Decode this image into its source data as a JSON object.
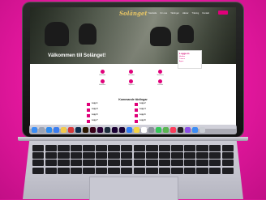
{
  "site": {
    "logo_text": "Solänget",
    "nav_items": [
      "Startsida",
      "Om oss",
      "Tävlingar",
      "Hästar",
      "Träning",
      "Kontakt"
    ],
    "hero_title": "Välkommen till Solänget!",
    "login_box": {
      "title": "Logga in",
      "links": [
        "Medlem",
        "Tränare",
        "Ägare"
      ]
    },
    "quick_links": [
      "Kalender",
      "Resultat",
      "Startlistor",
      "Anmälan",
      "Nyheter",
      "Kontakt"
    ],
    "upcoming_title": "Kommande tävlingar",
    "races": [
      {
        "name": "Lopp 1",
        "date": ""
      },
      {
        "name": "Lopp 2",
        "date": ""
      },
      {
        "name": "Lopp 3",
        "date": ""
      },
      {
        "name": "Lopp 4",
        "date": ""
      },
      {
        "name": "Lopp 5",
        "date": ""
      },
      {
        "name": "Lopp 6",
        "date": ""
      },
      {
        "name": "Lopp 7",
        "date": ""
      },
      {
        "name": "Lopp 8",
        "date": ""
      }
    ]
  },
  "colors": {
    "accent": "#e0007a",
    "background": "#e6189f"
  },
  "dock_icons": [
    "finder-icon",
    "launchpad-icon",
    "safari-icon",
    "mail-icon",
    "photos-icon",
    "pdf-icon",
    "photoshop-icon",
    "illustrator-icon",
    "indesign-icon",
    "xd-icon",
    "bridge-icon",
    "premiere-icon",
    "after-effects-icon",
    "appstore-icon",
    "notes-icon",
    "calendar-icon",
    "settings-icon",
    "messages-icon",
    "maps-icon",
    "music-icon",
    "tv-icon",
    "podcasts-icon",
    "finder2-icon",
    "trash-icon"
  ]
}
